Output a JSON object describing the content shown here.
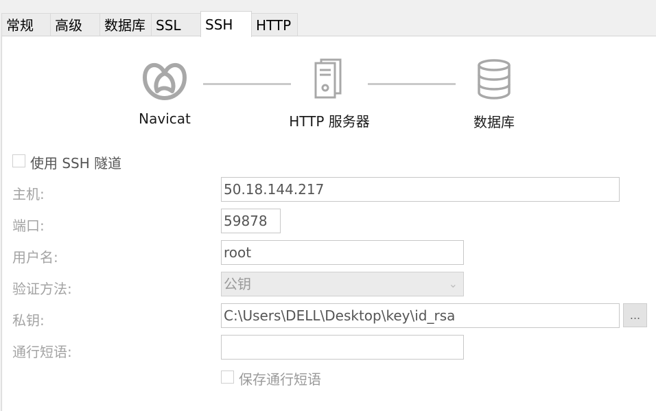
{
  "tabs": [
    {
      "label": "常规"
    },
    {
      "label": "高级"
    },
    {
      "label": "数据库"
    },
    {
      "label": "SSL"
    },
    {
      "label": "SSH"
    },
    {
      "label": "HTTP"
    }
  ],
  "active_tab": "SSH",
  "diagram": {
    "nodes": [
      {
        "label": "Navicat",
        "icon": "navicat-logo-icon"
      },
      {
        "label": "HTTP 服务器",
        "icon": "server-icon"
      },
      {
        "label": "数据库",
        "icon": "database-icon"
      }
    ]
  },
  "ssh_tunnel": {
    "label": "使用 SSH 隧道",
    "checked": false
  },
  "form": {
    "host": {
      "label": "主机:",
      "value": "50.18.144.217"
    },
    "port": {
      "label": "端口:",
      "value": "59878"
    },
    "username": {
      "label": "用户名:",
      "value": "root"
    },
    "auth_method": {
      "label": "验证方法:",
      "value": "公钥"
    },
    "private_key": {
      "label": "私钥:",
      "value": "C:\\Users\\DELL\\Desktop\\key\\id_rsa",
      "browse_label": "..."
    },
    "passphrase": {
      "label": "通行短语:",
      "value": ""
    },
    "save_passphrase": {
      "label": "保存通行短语",
      "checked": false
    }
  },
  "colors": {
    "panel_bg": "#ffffff",
    "window_bg": "#f0f0f0",
    "icon_gray": "#a8a8a8",
    "label_gray": "#a3a3a3"
  }
}
